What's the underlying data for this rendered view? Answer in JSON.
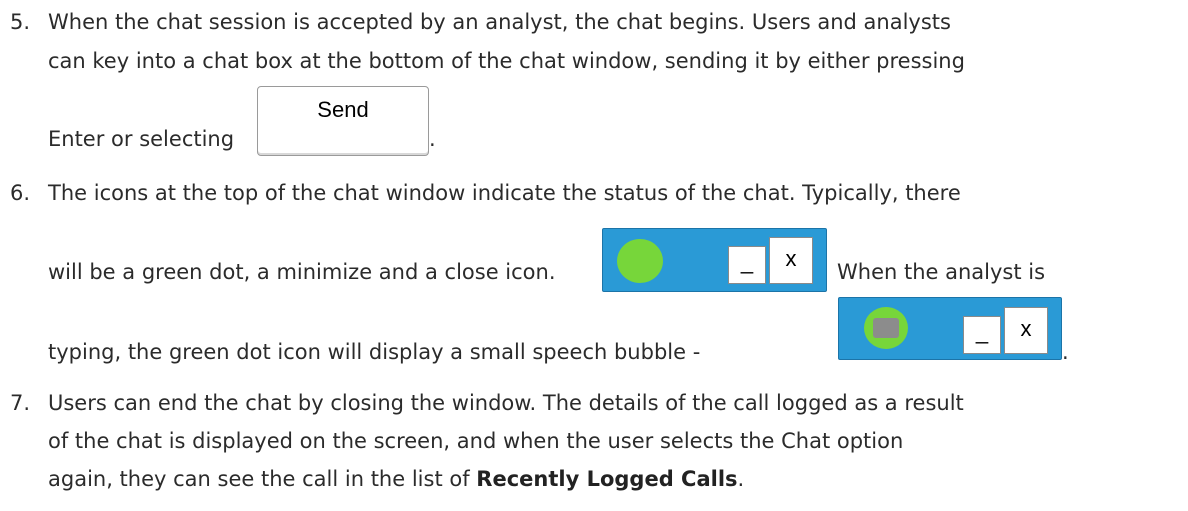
{
  "items": [
    {
      "number": "5.",
      "lines": [
        "When the chat session is accepted by an analyst, the chat begins. Users and analysts",
        "can key into a chat box at the bottom of the chat window, sending it by either pressing",
        "Enter or selecting",
        "."
      ],
      "send_button_label": "Send"
    },
    {
      "number": "6.",
      "lines": [
        "The icons at the top of the chat window indicate the status of the chat. Typically, there",
        "will be a green dot, a minimize and a close icon.",
        "When the analyst is",
        "typing, the green dot icon will display a small speech bubble -",
        "."
      ],
      "icon_strip": {
        "minimize_label": "_",
        "close_label": "x",
        "status_color": "#77d63a",
        "bar_color": "#2a9ad6"
      }
    },
    {
      "number": "7.",
      "lines": [
        "Users can end the chat by closing the window. The details of the call logged as a result",
        "of the chat is displayed on the screen, and when the user selects the Chat option",
        "again, they can see the call in the list of",
        "Recently Logged Calls",
        "."
      ]
    }
  ]
}
